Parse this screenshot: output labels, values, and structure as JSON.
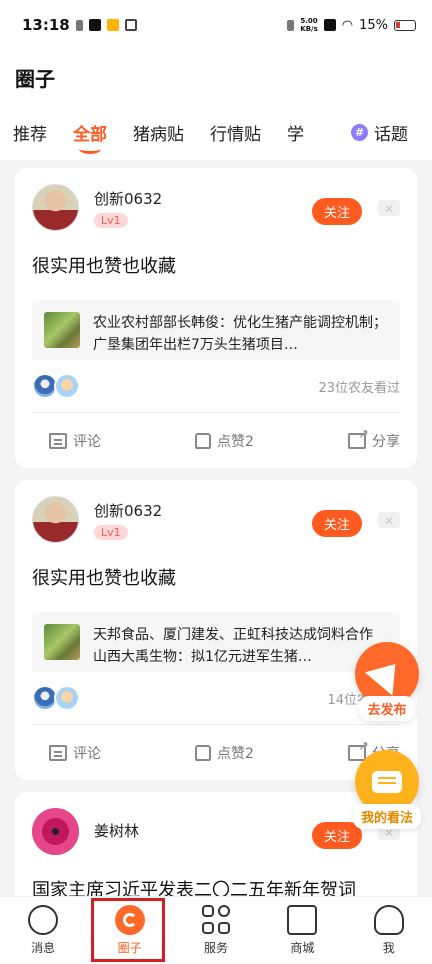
{
  "status_bar": {
    "time": "13:18",
    "net_speed_value": "5.00",
    "net_speed_unit": "KB/s",
    "battery": "15%"
  },
  "header": {
    "title": "圈子"
  },
  "tabs": [
    {
      "label": "推荐",
      "active": false
    },
    {
      "label": "全部",
      "active": true
    },
    {
      "label": "猪病贴",
      "active": false
    },
    {
      "label": "行情贴",
      "active": false
    },
    {
      "label": "学",
      "active": false
    }
  ],
  "topic_tab": {
    "icon": "#",
    "label": "话题"
  },
  "posts": [
    {
      "user": "创新0632",
      "level": "Lv1",
      "follow": "关注",
      "close": "×",
      "text": "很实用也赞也收藏",
      "link_title": "农业农村部部长韩俊：优化生猪产能调控机制；广垦集团年出栏7万头生猪项目…",
      "viewers": "23位农友看过",
      "actions": {
        "comment": "评论",
        "like": "点赞2",
        "share": "分享"
      }
    },
    {
      "user": "创新0632",
      "level": "Lv1",
      "follow": "关注",
      "close": "×",
      "text": "很实用也赞也收藏",
      "link_title": "天邦食品、厦门建发、正虹科技达成饲料合作 山西大禹生物：拟1亿元进军生猪…",
      "viewers": "14位农",
      "actions": {
        "comment": "评论",
        "like": "点赞2",
        "share": "分享"
      }
    },
    {
      "user": "姜树林",
      "follow": "关注",
      "close": "×",
      "text": "国家主席习近平发表二〇二五年新年贺词"
    }
  ],
  "fab": {
    "publish": "去发布",
    "my_view": "我的看法"
  },
  "bottom_nav": [
    {
      "label": "消息",
      "icon": "message-icon"
    },
    {
      "label": "圈子",
      "icon": "circle-icon",
      "active": true
    },
    {
      "label": "服务",
      "icon": "services-icon"
    },
    {
      "label": "商城",
      "icon": "shop-icon"
    },
    {
      "label": "我",
      "icon": "profile-icon"
    }
  ],
  "colors": {
    "accent": "#ff5a1f",
    "fab_secondary": "#ffb21c",
    "highlight": "#d42020"
  }
}
